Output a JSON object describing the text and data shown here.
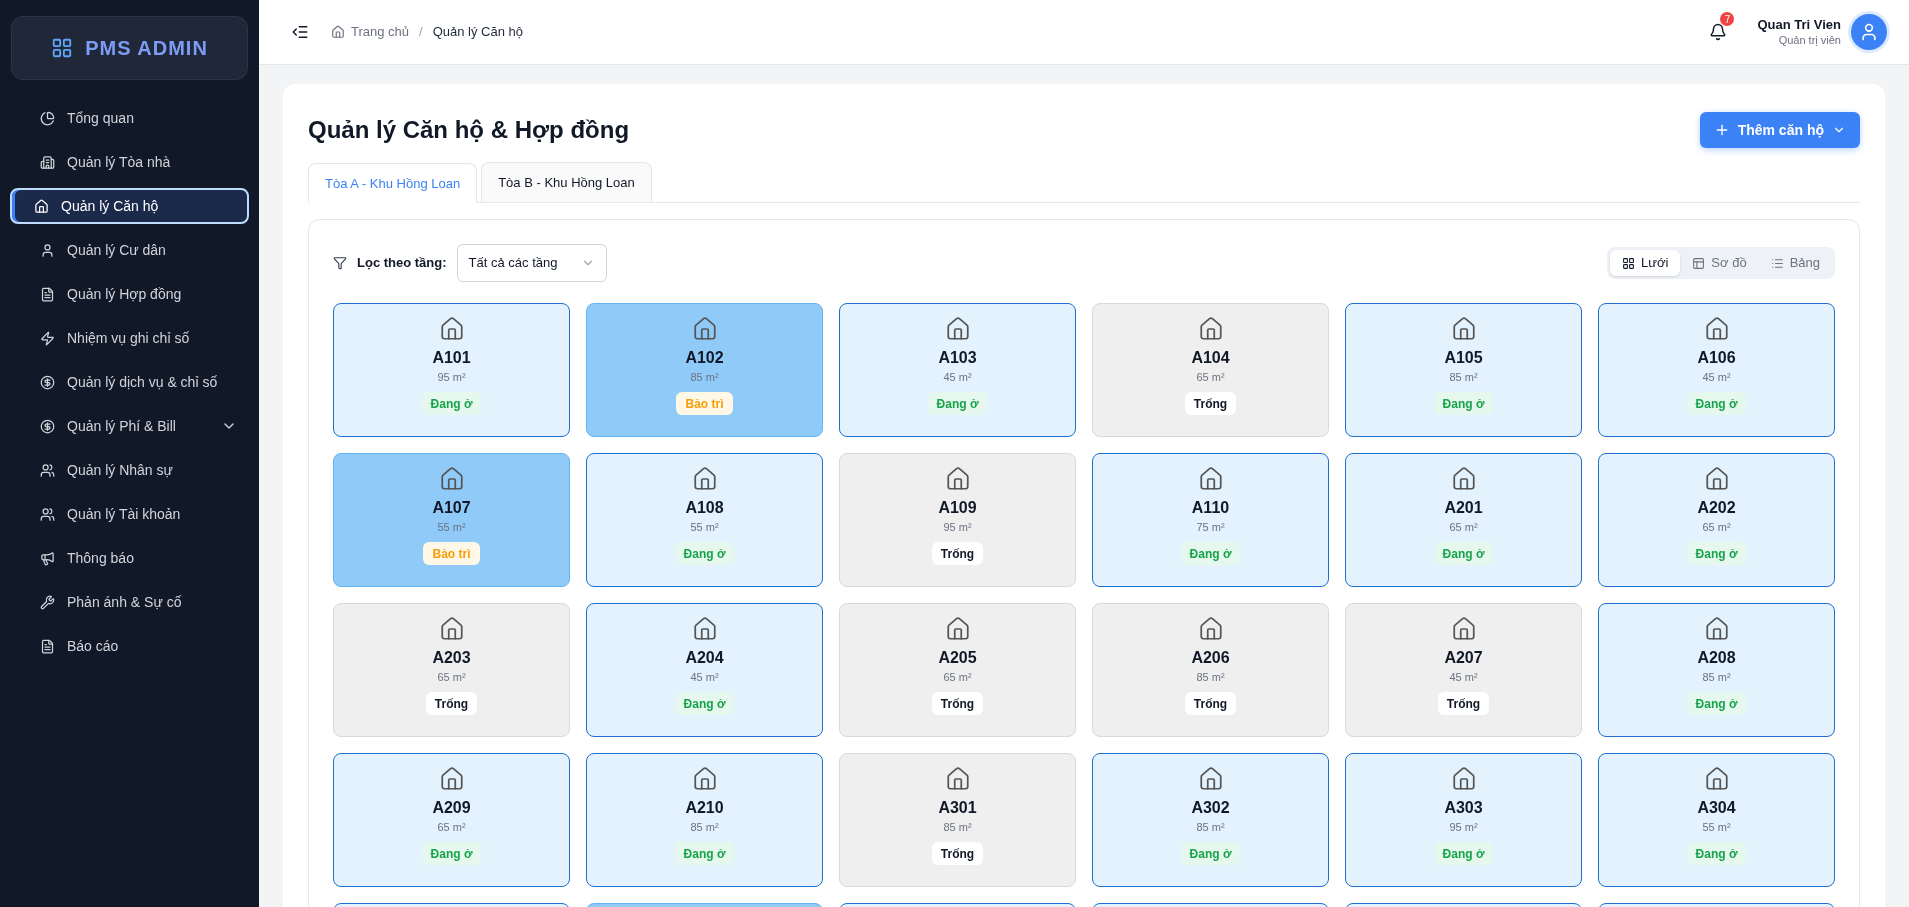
{
  "brand": {
    "title": "PMS ADMIN"
  },
  "sidebar": {
    "items": [
      {
        "label": "Tổng quan",
        "selected": false
      },
      {
        "label": "Quản lý Tòa nhà",
        "selected": false
      },
      {
        "label": "Quản lý Căn hộ",
        "selected": true
      },
      {
        "label": "Quản lý Cư dân",
        "selected": false
      },
      {
        "label": "Quản lý Hợp đồng",
        "selected": false
      },
      {
        "label": "Nhiệm vụ ghi chỉ số",
        "selected": false
      },
      {
        "label": "Quản lý dịch vụ & chỉ số",
        "selected": false
      },
      {
        "label": "Quản lý Phí & Bill",
        "selected": false,
        "expanded": false
      },
      {
        "label": "Quản lý Nhân sự",
        "selected": false
      },
      {
        "label": "Quản lý Tài khoản",
        "selected": false
      },
      {
        "label": "Thông báo",
        "selected": false
      },
      {
        "label": "Phản ánh & Sự cố",
        "selected": false
      },
      {
        "label": "Báo cáo",
        "selected": false
      }
    ]
  },
  "header": {
    "breadcrumb": [
      "Trang chủ",
      "Quản lý Căn hộ"
    ],
    "separator": "/",
    "notification_count": "7",
    "user_name": "Quan Tri Vien",
    "user_role": "Quản trị viên"
  },
  "page": {
    "title": "Quản lý Căn hộ & Hợp đồng",
    "add_button": "Thêm căn hộ"
  },
  "tabs": [
    {
      "label": "Tòa A - Khu Hồng Loan",
      "selected": true
    },
    {
      "label": "Tòa B - Khu Hồng Loan",
      "selected": false
    }
  ],
  "filter": {
    "label": "Lọc theo tầng:",
    "value": "Tất cả các tầng"
  },
  "views": [
    {
      "label": "Lưới",
      "selected": true
    },
    {
      "label": "Sơ đồ",
      "selected": false
    },
    {
      "label": "Bảng",
      "selected": false
    }
  ],
  "units": [
    {
      "name": "A101",
      "area": "95 m²",
      "kind": "occupied",
      "status_label": "Đang ở"
    },
    {
      "name": "A102",
      "area": "85 m²",
      "kind": "maintenance",
      "status_label": "Bảo trì"
    },
    {
      "name": "A103",
      "area": "45 m²",
      "kind": "occupied",
      "status_label": "Đang ở"
    },
    {
      "name": "A104",
      "area": "65 m²",
      "kind": "vacant",
      "status_label": "Trống"
    },
    {
      "name": "A105",
      "area": "85 m²",
      "kind": "occupied",
      "status_label": "Đang ở"
    },
    {
      "name": "A106",
      "area": "45 m²",
      "kind": "occupied",
      "status_label": "Đang ở"
    },
    {
      "name": "A107",
      "area": "55 m²",
      "kind": "maintenance",
      "status_label": "Bảo trì"
    },
    {
      "name": "A108",
      "area": "55 m²",
      "kind": "occupied",
      "status_label": "Đang ở"
    },
    {
      "name": "A109",
      "area": "95 m²",
      "kind": "vacant",
      "status_label": "Trống"
    },
    {
      "name": "A110",
      "area": "75 m²",
      "kind": "occupied",
      "status_label": "Đang ở"
    },
    {
      "name": "A201",
      "area": "65 m²",
      "kind": "occupied",
      "status_label": "Đang ở"
    },
    {
      "name": "A202",
      "area": "65 m²",
      "kind": "occupied",
      "status_label": "Đang ở"
    },
    {
      "name": "A203",
      "area": "65 m²",
      "kind": "vacant",
      "status_label": "Trống"
    },
    {
      "name": "A204",
      "area": "45 m²",
      "kind": "occupied",
      "status_label": "Đang ở"
    },
    {
      "name": "A205",
      "area": "65 m²",
      "kind": "vacant",
      "status_label": "Trống"
    },
    {
      "name": "A206",
      "area": "85 m²",
      "kind": "vacant",
      "status_label": "Trống"
    },
    {
      "name": "A207",
      "area": "45 m²",
      "kind": "vacant",
      "status_label": "Trống"
    },
    {
      "name": "A208",
      "area": "85 m²",
      "kind": "occupied",
      "status_label": "Đang ở"
    },
    {
      "name": "A209",
      "area": "65 m²",
      "kind": "occupied",
      "status_label": "Đang ở"
    },
    {
      "name": "A210",
      "area": "85 m²",
      "kind": "occupied",
      "status_label": "Đang ở"
    },
    {
      "name": "A301",
      "area": "85 m²",
      "kind": "vacant",
      "status_label": "Trống"
    },
    {
      "name": "A302",
      "area": "85 m²",
      "kind": "occupied",
      "status_label": "Đang ở"
    },
    {
      "name": "A303",
      "area": "95 m²",
      "kind": "occupied",
      "status_label": "Đang ở"
    },
    {
      "name": "A304",
      "area": "55 m²",
      "kind": "occupied",
      "status_label": "Đang ở"
    },
    {
      "kind": "occupied"
    },
    {
      "kind": "maintenance"
    },
    {
      "kind": "occupied"
    },
    {
      "kind": "occupied"
    },
    {
      "kind": "occupied"
    },
    {
      "kind": "occupied"
    }
  ]
}
